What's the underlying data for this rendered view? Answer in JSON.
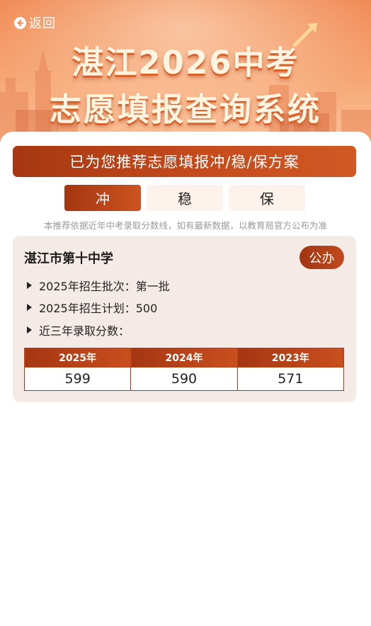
{
  "header": {
    "back_label": "返回",
    "title_line1": "湛江2026中考",
    "title_line2": "志愿填报查询系统"
  },
  "banner": {
    "text": "已为您推荐志愿填报冲/稳/保方案"
  },
  "tabs": [
    {
      "label": "冲",
      "active": true
    },
    {
      "label": "稳",
      "active": false
    },
    {
      "label": "保",
      "active": false
    }
  ],
  "note": "本推荐依据近年中考录取分数线，如有最新数据，以教育局官方公布为准",
  "school": {
    "name": "湛江市第十中学",
    "type_badge": "公办",
    "info": [
      "2025年招生批次：第一批",
      "2025年招生计划：500",
      "近三年录取分数："
    ],
    "score_table": {
      "headers": [
        "2025年",
        "2024年",
        "2023年"
      ],
      "values": [
        "599",
        "590",
        "571"
      ]
    }
  },
  "colors": {
    "accent": "#b4411a",
    "hero_top": "#f08a55",
    "card_bg": "#f5ebe6",
    "note_text": "#9a9a9a"
  },
  "icons": {
    "back": "arrow-left-circle-icon",
    "bullet": "triangle-right-icon"
  }
}
